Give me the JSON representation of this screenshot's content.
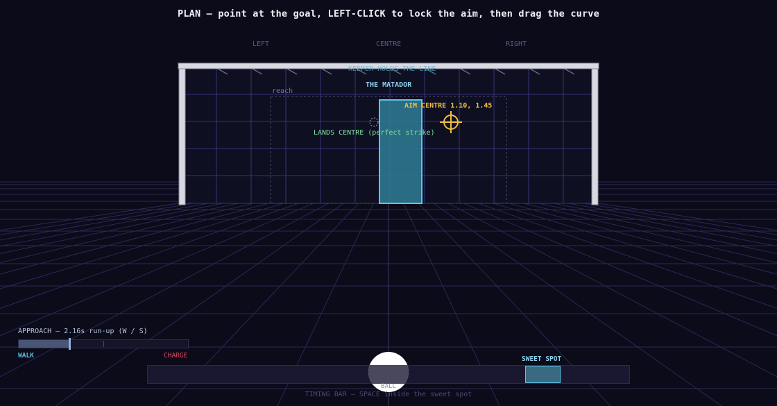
{
  "instruction": "PLAN — point at the goal, LEFT-CLICK to lock the aim, then drag the curve",
  "zones": {
    "left": "LEFT",
    "centre": "CENTRE",
    "right": "RIGHT"
  },
  "goal": {
    "caption": "KEEPER HOLDS THE LINE",
    "reach_label": "reach",
    "keeper_name": "THE MATADOR"
  },
  "aim": {
    "label": "AIM CENTRE  1.10, 1.45",
    "zone": "CENTRE",
    "x": 1.1,
    "y": 1.45,
    "color": "#f2c040"
  },
  "landing": {
    "label": "LANDS CENTRE (perfect strike)",
    "color": "#7ee2a0"
  },
  "approach": {
    "label": "APPROACH — 2.16s run-up   (W / S)",
    "run_up_seconds": 2.16,
    "fill_fraction": 0.3,
    "walk_label": "WALK",
    "charge_label": "CHARGE",
    "walk_color": "#5ab8e0",
    "charge_color": "#e04a5e"
  },
  "timing": {
    "sweet_spot_label": "SWEET SPOT",
    "ball_label": "BALL",
    "hint": "TIMING BAR — SPACE inside the sweet spot",
    "sweet_spot_range": [
      0.78,
      0.855
    ],
    "ball_position": 0.48
  },
  "colors": {
    "background": "#0b0b1a",
    "grid": "#2a2956",
    "goal_frame": "#d8d8e2",
    "keeper": "#3aa8c8",
    "accent": "#5ac8e8"
  },
  "icons": {
    "crosshair": "crosshair-icon",
    "target": "target-ring-icon"
  }
}
